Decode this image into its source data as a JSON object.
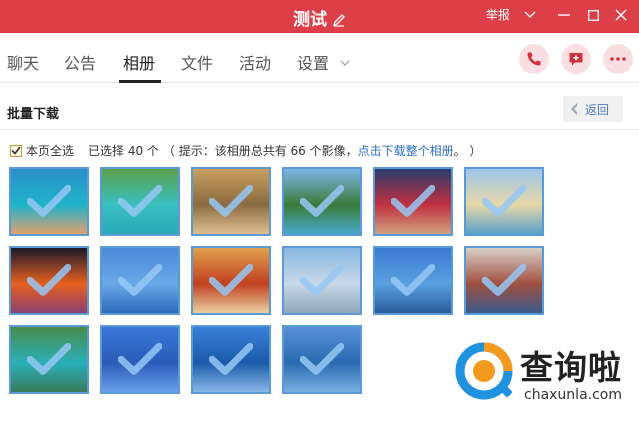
{
  "window": {
    "title": "测试",
    "report_label": "举报",
    "colors": {
      "titlebar": "#dd3f48",
      "accent": "#2f6fc4"
    }
  },
  "tabs": [
    {
      "label": "聊天",
      "active": false
    },
    {
      "label": "公告",
      "active": false
    },
    {
      "label": "相册",
      "active": true
    },
    {
      "label": "文件",
      "active": false
    },
    {
      "label": "活动",
      "active": false
    },
    {
      "label": "设置",
      "active": false
    }
  ],
  "action_icons": [
    "phone-icon",
    "add-comment-icon",
    "more-icon"
  ],
  "subheader": {
    "title": "批量下载",
    "back_label": "返回"
  },
  "selection": {
    "select_all_label": "本页全选",
    "select_all_checked": true,
    "selected_text": "已选择 40 个",
    "hint_prefix": "（ 提示：该相册总共有 66 个影像，",
    "hint_link": "点击下载整个相册",
    "hint_suffix": "。 ）"
  },
  "photos": [
    {
      "name": "snorkel-underwater",
      "colors": [
        "#2a8fc9",
        "#1fb3c8",
        "#e0a070"
      ]
    },
    {
      "name": "turquoise-cliff-bay",
      "colors": [
        "#5aa04a",
        "#3ac0c0",
        "#2aa8b8"
      ]
    },
    {
      "name": "seafood-platter",
      "colors": [
        "#c9a060",
        "#8a6a40",
        "#e0c090"
      ]
    },
    {
      "name": "island-beach",
      "colors": [
        "#7fb6e8",
        "#3a7a3a",
        "#4aa8c8"
      ]
    },
    {
      "name": "child-red-shirt",
      "colors": [
        "#2a3a6a",
        "#c03040",
        "#d0a080"
      ]
    },
    {
      "name": "beach-palms",
      "colors": [
        "#9cc6e8",
        "#e8d8a8",
        "#5aa0c8"
      ]
    },
    {
      "name": "night-market-lights",
      "colors": [
        "#1a1a2a",
        "#e86020",
        "#8a4070"
      ]
    },
    {
      "name": "blue-sky-sea",
      "colors": [
        "#4a8ad8",
        "#6aa8e8",
        "#2a6ab8"
      ]
    },
    {
      "name": "thai-dishes",
      "colors": [
        "#e0a050",
        "#c04020",
        "#e8d0a0"
      ]
    },
    {
      "name": "calm-shore",
      "colors": [
        "#8ab8e0",
        "#c8d8e8",
        "#90a8b8"
      ]
    },
    {
      "name": "longtail-boat-sea",
      "colors": [
        "#3a7ad0",
        "#5aa0e0",
        "#2a5a98"
      ]
    },
    {
      "name": "girl-by-sculpture",
      "colors": [
        "#d8d0c8",
        "#a05040",
        "#3a5a8a"
      ]
    },
    {
      "name": "lagoon-cliffs",
      "colors": [
        "#4a8a4a",
        "#2ab0b8",
        "#3a7a5a"
      ]
    },
    {
      "name": "deep-blue-sea",
      "colors": [
        "#3a78d8",
        "#2a5ab8",
        "#6aa0e8"
      ]
    },
    {
      "name": "boat-wake-ocean",
      "colors": [
        "#3a80d8",
        "#1a5aa8",
        "#8ab8e8"
      ]
    },
    {
      "name": "open-ocean",
      "colors": [
        "#5a90d8",
        "#2a6ab0",
        "#7ab0e0"
      ]
    }
  ],
  "watermark": {
    "text": "查询啦",
    "sub": "chaxunla.com"
  }
}
